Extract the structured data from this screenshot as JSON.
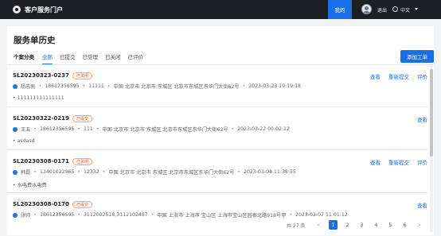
{
  "header": {
    "app_title": "客户服务门户",
    "mine_label": "我的",
    "logout_label": "退出",
    "language_label": "中文"
  },
  "page": {
    "title": "服务单历史",
    "category_label": "个案分类",
    "tabs": [
      "全部",
      "已提交",
      "已受理",
      "已关闭",
      "已评价"
    ],
    "active_tab": "全部",
    "add_button_label": "添加工单"
  },
  "colors": {
    "accent": "#1a6fe8",
    "status_badge": "#e8592a",
    "topbar": "#1d1f24"
  },
  "tickets": [
    {
      "number": "SL20230323-0237",
      "status": "已关闭",
      "name": "杨志刚",
      "phone": "18612356595",
      "code": "11111",
      "address": "中国 北京市 北京市 东城区 北京市东城区东华门大街62号",
      "time": "2023-03-23 19:19:18",
      "description": "111111111111111",
      "actions": [
        "查看",
        "重新提交",
        "评价"
      ]
    },
    {
      "number": "SL20230322-0219",
      "status": "已提交",
      "name": "王五",
      "phone": "18612356595",
      "code": "111",
      "address": "中国 北京市 北京市 东城区 北京市东城区东华门大街62号",
      "time": "2023-03-22 00:02:12",
      "description": "asdasd",
      "actions": [
        "查看"
      ]
    },
    {
      "number": "SL20230308-0171",
      "status": "已关闭",
      "name": "韩磊",
      "phone": "13401022965",
      "code": "12332",
      "address": "中国 北京市 北京市 东城区 北京市东城区东华门大街62号",
      "time": "2023-03-08 11:38:55",
      "description": "水电费水电费",
      "actions": [
        "查看",
        "重新提交",
        "评价"
      ]
    },
    {
      "number": "SL20230308-0170",
      "status": "已提交",
      "name": "张帅",
      "phone": "18612356595",
      "code": "3112002518,3112102487",
      "address": "中国 上海市 上海市 宝山区 上海市宝山区园泰北路918号甲",
      "time": "2023-03-07 11:01:12",
      "description": "",
      "actions": [
        "查看"
      ]
    }
  ],
  "pagination": {
    "total_label": "共 27 条",
    "prev": "<",
    "next": ">",
    "pages": [
      "1",
      "2",
      "3",
      "4",
      "5",
      "6"
    ],
    "current": "1"
  }
}
